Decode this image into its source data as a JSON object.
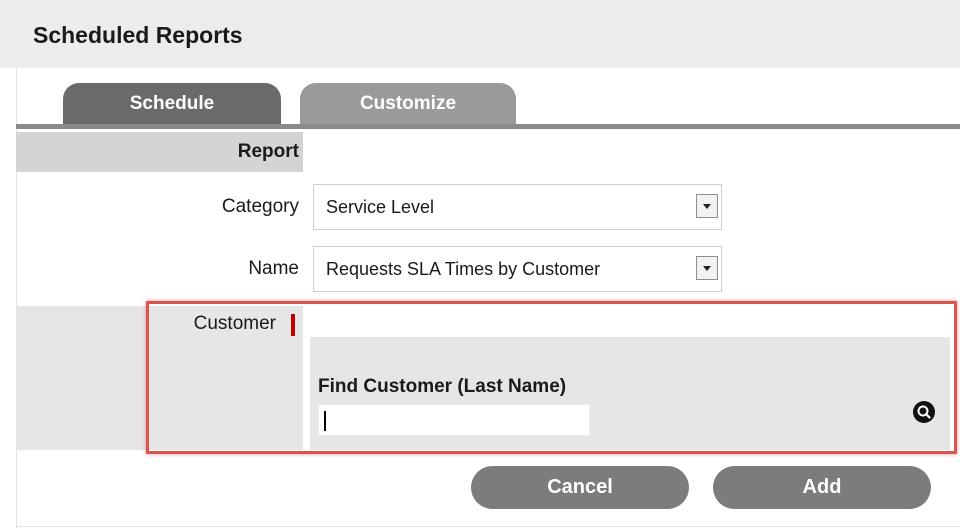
{
  "header": {
    "title": "Scheduled Reports"
  },
  "tabs": [
    {
      "label": "Schedule",
      "active": true
    },
    {
      "label": "Customize",
      "active": false
    }
  ],
  "form": {
    "section_label": "Report",
    "category": {
      "label": "Category",
      "value": "Service Level"
    },
    "name": {
      "label": "Name",
      "value": "Requests SLA Times by Customer"
    },
    "customer": {
      "label": "Customer",
      "required": true,
      "find_label": "Find Customer (Last Name)",
      "find_value": ""
    }
  },
  "actions": {
    "cancel": "Cancel",
    "add": "Add"
  },
  "colors": {
    "highlight": "#d9534f",
    "required": "#c00000",
    "button": "#7c7c7c"
  }
}
